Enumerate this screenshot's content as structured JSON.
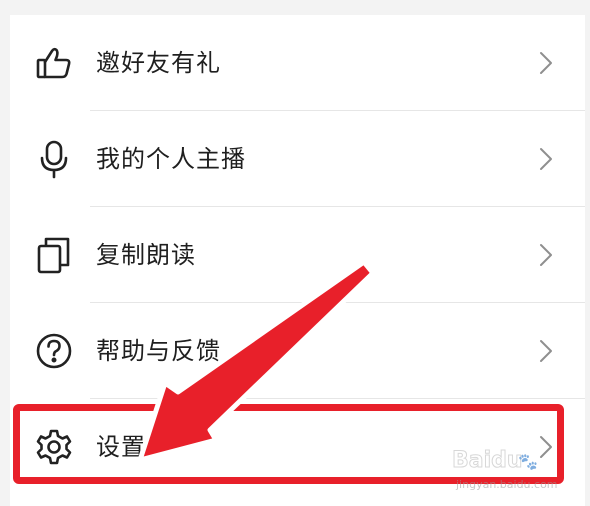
{
  "menu": {
    "items": [
      {
        "label": "邀好友有礼",
        "icon": "thumbs-up-icon"
      },
      {
        "label": "我的个人主播",
        "icon": "microphone-icon"
      },
      {
        "label": "复制朗读",
        "icon": "copy-icon"
      },
      {
        "label": "帮助与反馈",
        "icon": "help-circle-icon"
      },
      {
        "label": "设置",
        "icon": "gear-icon"
      }
    ],
    "chevron_icon": "chevron-right-icon"
  },
  "annotation": {
    "color": "#e8202a",
    "highlighted_item": "设置"
  },
  "watermark": {
    "brand": "Baidu",
    "domain": "jingyan.baidu.com"
  }
}
